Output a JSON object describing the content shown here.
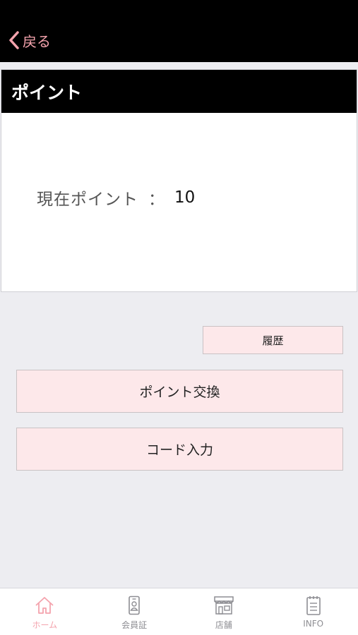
{
  "header": {
    "back_label": "戻る"
  },
  "card": {
    "title": "ポイント",
    "points_label": "現在ポイント",
    "separator": "：",
    "points_value": "10"
  },
  "actions": {
    "history_label": "履歴",
    "exchange_label": "ポイント交換",
    "code_label": "コード入力"
  },
  "tabbar": {
    "items": [
      {
        "label": "ホーム",
        "icon": "home-icon",
        "active": true
      },
      {
        "label": "会員証",
        "icon": "member-card-icon",
        "active": false
      },
      {
        "label": "店舗",
        "icon": "store-icon",
        "active": false
      },
      {
        "label": "INFO",
        "icon": "info-list-icon",
        "active": false
      }
    ]
  },
  "colors": {
    "accent": "#f4a3ad",
    "button_bg": "#fde8ea",
    "header_bg": "#000000",
    "page_bg": "#ededf1"
  }
}
